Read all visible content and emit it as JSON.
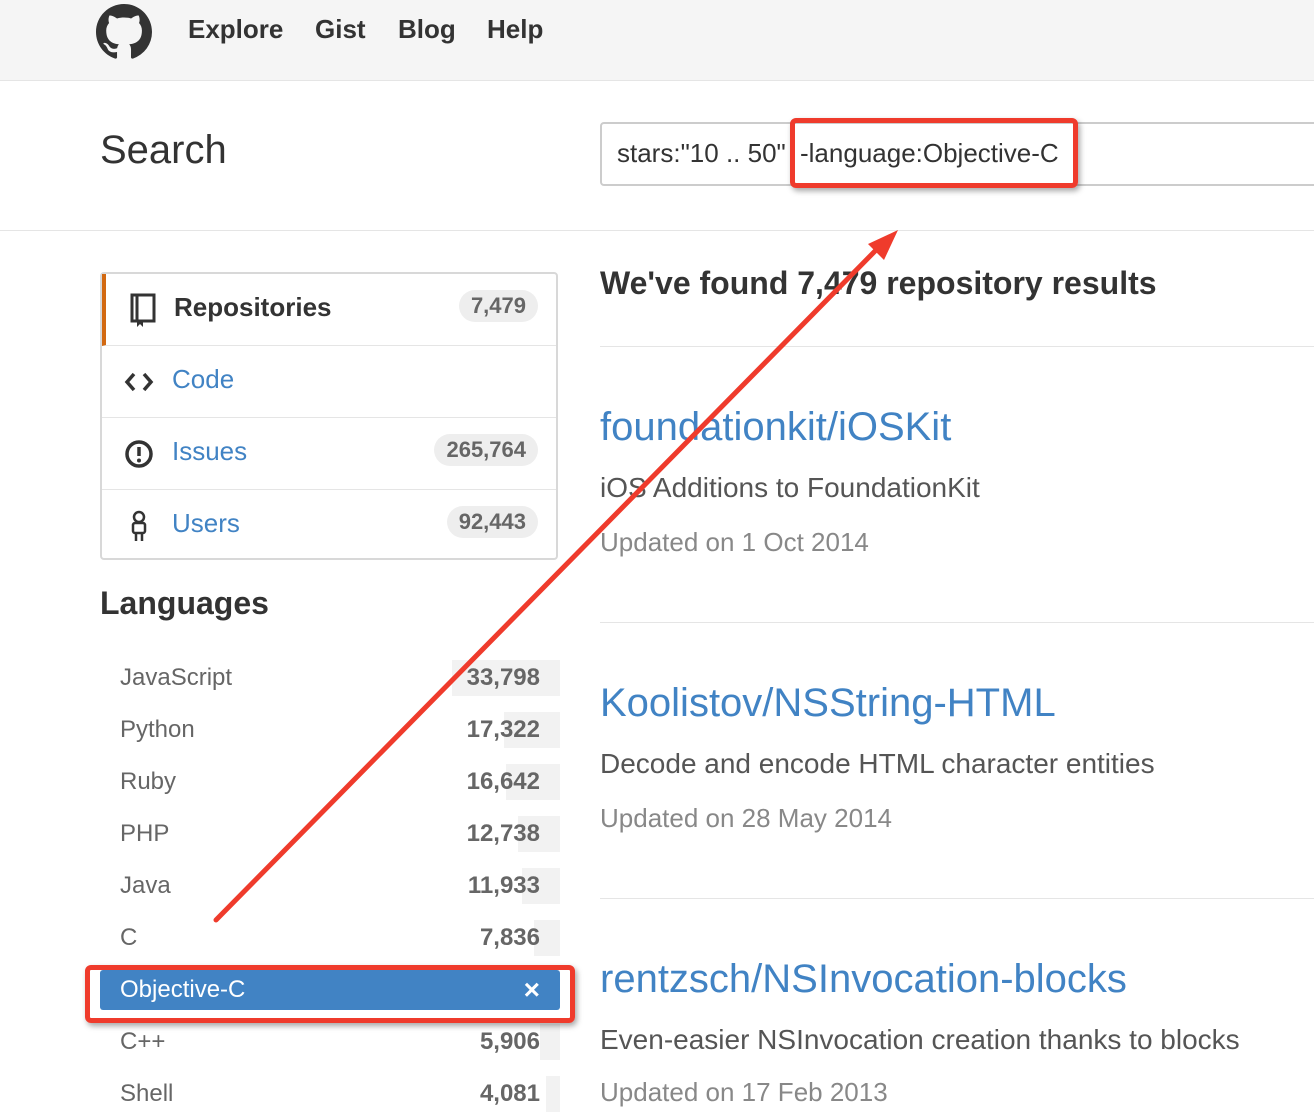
{
  "header": {
    "nav": [
      "Explore",
      "Gist",
      "Blog",
      "Help"
    ]
  },
  "search": {
    "title": "Search",
    "query_prefix": "stars:\"10 .. 50\"",
    "query_highlight": "-language:Objective-C"
  },
  "menu": {
    "items": [
      {
        "label": "Repositories",
        "count": "7,479",
        "icon": "repo-icon"
      },
      {
        "label": "Code",
        "count": "",
        "icon": "code-icon"
      },
      {
        "label": "Issues",
        "count": "265,764",
        "icon": "issue-icon"
      },
      {
        "label": "Users",
        "count": "92,443",
        "icon": "user-icon"
      }
    ]
  },
  "languages": {
    "title": "Languages",
    "items": [
      {
        "name": "JavaScript",
        "count": "33,798"
      },
      {
        "name": "Python",
        "count": "17,322"
      },
      {
        "name": "Ruby",
        "count": "16,642"
      },
      {
        "name": "PHP",
        "count": "12,738"
      },
      {
        "name": "Java",
        "count": "11,933"
      },
      {
        "name": "C",
        "count": "7,836"
      },
      {
        "name": "Objective-C",
        "count": "",
        "close": "×"
      },
      {
        "name": "C++",
        "count": "5,906"
      },
      {
        "name": "Shell",
        "count": "4,081"
      }
    ]
  },
  "results": {
    "heading": "We've found 7,479 repository results",
    "repos": [
      {
        "name": "foundationkit/iOSKit",
        "description": "iOS Additions to FoundationKit",
        "updated": "Updated on 1 Oct 2014"
      },
      {
        "name": "Koolistov/NSString-HTML",
        "description": "Decode and encode HTML character entities",
        "updated": "Updated on 28 May 2014"
      },
      {
        "name": "rentzsch/NSInvocation-blocks",
        "description": "Even-easier NSInvocation creation thanks to blocks",
        "updated": "Updated on 17 Feb 2013"
      }
    ]
  },
  "colors": {
    "link": "#4183c4",
    "selected_tab_accent": "#d26911",
    "annotation": "#ef3b2c"
  }
}
